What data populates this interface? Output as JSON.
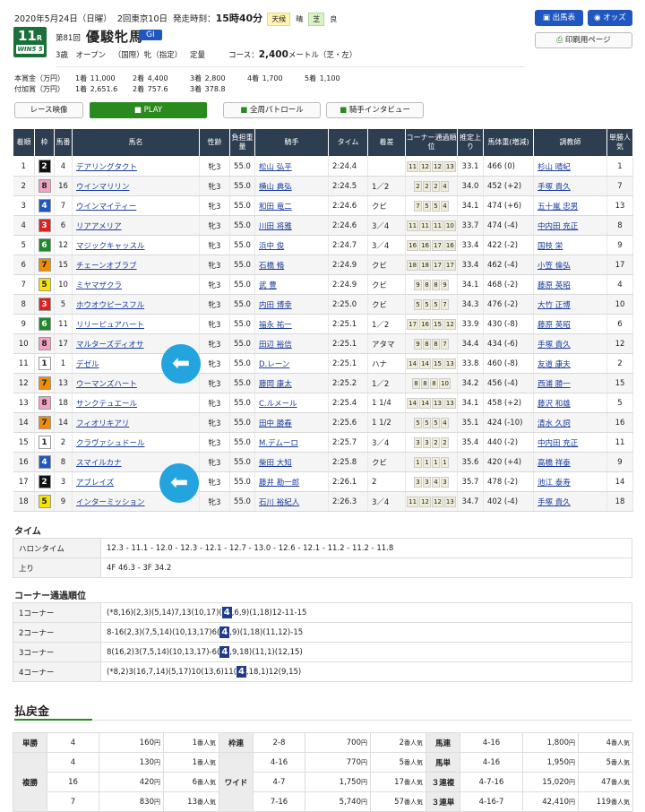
{
  "header": {
    "date": "2020年5月24日（日曜）",
    "meeting": "2回東京10日",
    "post_time_label": "発走時刻：",
    "post_time": "15時40分",
    "weather_label": "天候",
    "weather": "晴",
    "track_label": "芝",
    "track": "良"
  },
  "race": {
    "number": "11",
    "number_suffix": "R",
    "wins_logo": "WIN5",
    "wins_num": "5",
    "kai": "第81回",
    "name": "優駿牝馬",
    "grade": "GI",
    "conditions": "3歳 オープン （国際）牝（指定） 定量",
    "course_label": "コース：",
    "distance": "2,400",
    "course_detail": "メートル（芝・左）"
  },
  "buttons": {
    "card": "出馬表",
    "odds": "オッズ",
    "print": "印刷用ページ",
    "video": "レース映像",
    "play": "PLAY",
    "patrol": "全周パトロール",
    "interview": "騎手インタビュー"
  },
  "prize": {
    "main_label": "本賞金（万円）",
    "main": [
      [
        "1着",
        "11,000"
      ],
      [
        "2着",
        "4,400"
      ],
      [
        "3着",
        "2,800"
      ],
      [
        "4着",
        "1,700"
      ],
      [
        "5着",
        "1,100"
      ]
    ],
    "add_label": "付加賞（万円）",
    "add": [
      [
        "1着",
        "2,651.6"
      ],
      [
        "2着",
        "757.6"
      ],
      [
        "3着",
        "378.8"
      ]
    ]
  },
  "table_headers": [
    "着順",
    "枠",
    "馬番",
    "馬名",
    "性齢",
    "負担重量",
    "騎手",
    "タイム",
    "着差",
    "コーナー通過順位",
    "推定上り",
    "馬体重(増減)",
    "調教師",
    "単勝人気"
  ],
  "results": [
    {
      "pos": "1",
      "waku": "2",
      "num": "4",
      "horse": "デアリングタクト",
      "sex": "牝3",
      "wt": "55.0",
      "jockey": "松山 弘平",
      "time": "2:24.4",
      "margin": "",
      "corners": [
        "11",
        "12",
        "12",
        "13"
      ],
      "agari": "33.1",
      "bw": "466 (0)",
      "trainer": "杉山 晴紀",
      "pop": "1"
    },
    {
      "pos": "2",
      "waku": "8",
      "num": "16",
      "horse": "ウインマリリン",
      "sex": "牝3",
      "wt": "55.0",
      "jockey": "横山 典弘",
      "time": "2:24.5",
      "margin": "1／2",
      "corners": [
        "2",
        "2",
        "2",
        "4"
      ],
      "agari": "34.0",
      "bw": "452 (+2)",
      "trainer": "手塚 貴久",
      "pop": "7"
    },
    {
      "pos": "3",
      "waku": "4",
      "num": "7",
      "horse": "ウインマイティー",
      "sex": "牝3",
      "wt": "55.0",
      "jockey": "和田 竜二",
      "time": "2:24.6",
      "margin": "クビ",
      "corners": [
        "7",
        "5",
        "5",
        "4"
      ],
      "agari": "34.1",
      "bw": "474 (+6)",
      "trainer": "五十嵐 忠男",
      "pop": "13"
    },
    {
      "pos": "4",
      "waku": "3",
      "num": "6",
      "horse": "リアアメリア",
      "sex": "牝3",
      "wt": "55.0",
      "jockey": "川田 将雅",
      "time": "2:24.6",
      "margin": "3／4",
      "corners": [
        "11",
        "11",
        "11",
        "10"
      ],
      "agari": "33.7",
      "bw": "474 (-4)",
      "trainer": "中内田 充正",
      "pop": "8"
    },
    {
      "pos": "5",
      "waku": "6",
      "num": "12",
      "horse": "マジックキャッスル",
      "sex": "牝3",
      "wt": "55.0",
      "jockey": "浜中 俊",
      "time": "2:24.7",
      "margin": "3／4",
      "corners": [
        "16",
        "16",
        "17",
        "16"
      ],
      "agari": "33.4",
      "bw": "422 (-2)",
      "trainer": "国枝 栄",
      "pop": "9"
    },
    {
      "pos": "6",
      "waku": "7",
      "num": "15",
      "horse": "チェーンオブラブ",
      "sex": "牝3",
      "wt": "55.0",
      "jockey": "石橋 脩",
      "time": "2:24.9",
      "margin": "クビ",
      "corners": [
        "18",
        "18",
        "17",
        "17"
      ],
      "agari": "33.4",
      "bw": "462 (-4)",
      "trainer": "小笠 倫弘",
      "pop": "17"
    },
    {
      "pos": "7",
      "waku": "5",
      "num": "10",
      "horse": "ミヤマザクラ",
      "sex": "牝3",
      "wt": "55.0",
      "jockey": "武 豊",
      "time": "2:24.9",
      "margin": "クビ",
      "corners": [
        "9",
        "8",
        "8",
        "9"
      ],
      "agari": "34.1",
      "bw": "468 (-2)",
      "trainer": "藤原 英昭",
      "pop": "4"
    },
    {
      "pos": "8",
      "waku": "3",
      "num": "5",
      "horse": "ホウオウピースフル",
      "sex": "牝3",
      "wt": "55.0",
      "jockey": "内田 博幸",
      "time": "2:25.0",
      "margin": "クビ",
      "corners": [
        "5",
        "5",
        "5",
        "7"
      ],
      "agari": "34.3",
      "bw": "476 (-2)",
      "trainer": "大竹 正博",
      "pop": "10"
    },
    {
      "pos": "9",
      "waku": "6",
      "num": "11",
      "horse": "リリーピュアハート",
      "sex": "牝3",
      "wt": "55.0",
      "jockey": "福永 祐一",
      "time": "2:25.1",
      "margin": "1／2",
      "corners": [
        "17",
        "16",
        "15",
        "12"
      ],
      "agari": "33.9",
      "bw": "430 (-8)",
      "trainer": "藤原 英昭",
      "pop": "6"
    },
    {
      "pos": "10",
      "waku": "8",
      "num": "17",
      "horse": "マルターズディオサ",
      "sex": "牝3",
      "wt": "55.0",
      "jockey": "田辺 裕信",
      "time": "2:25.1",
      "margin": "アタマ",
      "corners": [
        "9",
        "8",
        "8",
        "7"
      ],
      "agari": "34.4",
      "bw": "434 (-6)",
      "trainer": "手塚 貴久",
      "pop": "12"
    },
    {
      "pos": "11",
      "waku": "1",
      "num": "1",
      "horse": "デゼル",
      "sex": "牝3",
      "wt": "55.0",
      "jockey": "D.レーン",
      "time": "2:25.1",
      "margin": "ハナ",
      "corners": [
        "14",
        "14",
        "15",
        "13"
      ],
      "agari": "33.8",
      "bw": "460 (-8)",
      "trainer": "友道 康夫",
      "pop": "2"
    },
    {
      "pos": "12",
      "waku": "7",
      "num": "13",
      "horse": "ウーマンズハート",
      "sex": "牝3",
      "wt": "55.0",
      "jockey": "藤岡 康太",
      "time": "2:25.2",
      "margin": "1／2",
      "corners": [
        "8",
        "8",
        "8",
        "10"
      ],
      "agari": "34.2",
      "bw": "456 (-4)",
      "trainer": "西浦 勝一",
      "pop": "15"
    },
    {
      "pos": "13",
      "waku": "8",
      "num": "18",
      "horse": "サンクテュエール",
      "sex": "牝3",
      "wt": "55.0",
      "jockey": "C.ルメール",
      "time": "2:25.4",
      "margin": "1 1/4",
      "corners": [
        "14",
        "14",
        "13",
        "13"
      ],
      "agari": "34.1",
      "bw": "458 (+2)",
      "trainer": "藤沢 和雄",
      "pop": "5"
    },
    {
      "pos": "14",
      "waku": "7",
      "num": "14",
      "horse": "フィオリキアリ",
      "sex": "牝3",
      "wt": "55.0",
      "jockey": "田中 勝春",
      "time": "2:25.6",
      "margin": "1 1/2",
      "corners": [
        "5",
        "5",
        "5",
        "4"
      ],
      "agari": "35.1",
      "bw": "424 (-10)",
      "trainer": "清水 久詞",
      "pop": "16"
    },
    {
      "pos": "15",
      "waku": "1",
      "num": "2",
      "horse": "クラヴァシュドール",
      "sex": "牝3",
      "wt": "55.0",
      "jockey": "M.デムーロ",
      "time": "2:25.7",
      "margin": "3／4",
      "corners": [
        "3",
        "3",
        "2",
        "2"
      ],
      "agari": "35.4",
      "bw": "440 (-2)",
      "trainer": "中内田 充正",
      "pop": "11"
    },
    {
      "pos": "16",
      "waku": "4",
      "num": "8",
      "horse": "スマイルカナ",
      "sex": "牝3",
      "wt": "55.0",
      "jockey": "柴田 大知",
      "time": "2:25.8",
      "margin": "クビ",
      "corners": [
        "1",
        "1",
        "1",
        "1"
      ],
      "agari": "35.6",
      "bw": "420 (+4)",
      "trainer": "高橋 祥泰",
      "pop": "9"
    },
    {
      "pos": "17",
      "waku": "2",
      "num": "3",
      "horse": "アブレイズ",
      "sex": "牝3",
      "wt": "55.0",
      "jockey": "藤井 勘一郎",
      "time": "2:26.1",
      "margin": "2",
      "corners": [
        "3",
        "3",
        "4",
        "3"
      ],
      "agari": "35.7",
      "bw": "478 (-2)",
      "trainer": "池江 泰寿",
      "pop": "14"
    },
    {
      "pos": "18",
      "waku": "5",
      "num": "9",
      "horse": "インターミッション",
      "sex": "牝3",
      "wt": "55.0",
      "jockey": "石川 裕紀人",
      "time": "2:26.3",
      "margin": "3／4",
      "corners": [
        "11",
        "12",
        "12",
        "13"
      ],
      "agari": "34.7",
      "bw": "402 (-4)",
      "trainer": "手塚 貴久",
      "pop": "18"
    }
  ],
  "waku_colors": {
    "1": [
      "#ffffff",
      "#222"
    ],
    "2": [
      "#111111",
      "#fff"
    ],
    "3": [
      "#e02020",
      "#fff"
    ],
    "4": [
      "#1f56c0",
      "#fff"
    ],
    "5": [
      "#f5e400",
      "#222"
    ],
    "6": [
      "#1f8a2a",
      "#fff"
    ],
    "7": [
      "#f08c00",
      "#222"
    ],
    "8": [
      "#f6a1c4",
      "#222"
    ]
  },
  "time_section": {
    "title": "タイム",
    "halon_label": "ハロンタイム",
    "halon": "12.3 - 11.1 - 12.0 - 12.3 - 12.1 - 12.7 - 13.0 - 12.6 - 12.1 - 11.2 - 11.2 - 11.8",
    "agari_label": "上り",
    "agari": "4F 46.3 - 3F 34.2"
  },
  "corner_section": {
    "title": "コーナー通過順位",
    "rows": [
      {
        "label": "1コーナー",
        "pre": "(*8,16)(2,3)(5,14)7,13(10,17)(",
        "hl": "4",
        "post": ",6,9)(1,18)12-11-15"
      },
      {
        "label": "2コーナー",
        "pre": "8-16(2,3)(7,5,14)(10,13,17)6(",
        "hl": "4",
        "post": ",9)(1,18)(11,12)-15"
      },
      {
        "label": "3コーナー",
        "pre": "8(16,2)3(7,5,14)(10,13,17)-6(",
        "hl": "4",
        "post": ",9,18)(11,1)(12,15)"
      },
      {
        "label": "4コーナー",
        "pre": "(*8,2)3(16,7,14)(5,17)10(13,6)11(",
        "hl": "4",
        "post": ",18,1)12(9,15)"
      }
    ]
  },
  "payout": {
    "title": "払戻金",
    "tansho": {
      "label": "単勝",
      "num": "4",
      "amt": "160",
      "pop": "1"
    },
    "fukusho": {
      "label": "複勝",
      "rows": [
        [
          "4",
          "130",
          "1"
        ],
        [
          "16",
          "420",
          "6"
        ],
        [
          "7",
          "830",
          "13"
        ]
      ]
    },
    "wakuren": {
      "label": "枠連",
      "num": "2-8",
      "amt": "700",
      "pop": "2"
    },
    "wide": {
      "label": "ワイド",
      "rows": [
        [
          "4-16",
          "770",
          "5"
        ],
        [
          "4-7",
          "1,750",
          "17"
        ],
        [
          "7-16",
          "5,740",
          "57"
        ]
      ]
    },
    "umaren": {
      "label": "馬連",
      "num": "4-16",
      "amt": "1,800",
      "pop": "4"
    },
    "umatan": {
      "label": "馬単",
      "num": "4-16",
      "amt": "1,950",
      "pop": "5"
    },
    "sanrenpuku": {
      "label": "３連複",
      "num": "4-7-16",
      "amt": "15,020",
      "pop": "47"
    },
    "sanrentan": {
      "label": "３連単",
      "num": "4-16-7",
      "amt": "42,410",
      "pop": "119"
    },
    "yen": "円",
    "pop_suffix": "番人気"
  }
}
